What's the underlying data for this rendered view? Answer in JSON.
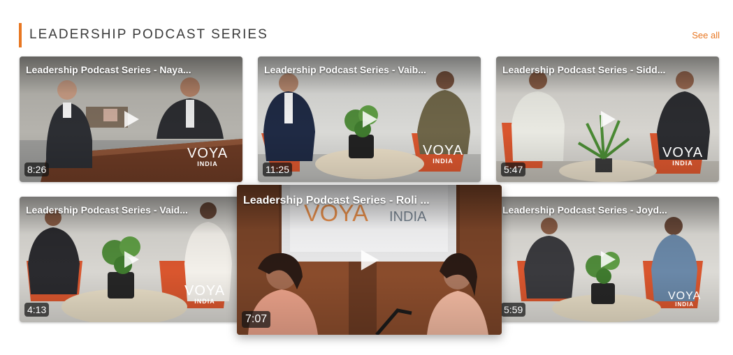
{
  "section": {
    "title": "LEADERSHIP PODCAST SERIES",
    "see_all": "See all",
    "accent_color": "#e87722"
  },
  "videos": [
    {
      "title": "Leadership Podcast Series - Naya...",
      "duration": "8:26",
      "brand": "VOYA",
      "brand_sub": "INDIA"
    },
    {
      "title": "Leadership Podcast Series - Vaib...",
      "duration": "11:25",
      "brand": "VOYA",
      "brand_sub": "INDIA"
    },
    {
      "title": "Leadership Podcast Series - Sidd...",
      "duration": "5:47",
      "brand": "VOYA",
      "brand_sub": "INDIA"
    },
    {
      "title": "Leadership Podcast Series - Vaid...",
      "duration": "4:13",
      "brand": "VOYA",
      "brand_sub": "INDIA"
    },
    {
      "title": "Leadership Podcast Series - Roli ...",
      "duration": "7:07",
      "brand": "VOYA",
      "brand_sub": "INDIA",
      "featured": true
    },
    {
      "title": "Leadership Podcast Series - Joyd...",
      "duration": "5:59",
      "brand": "VOYA",
      "brand_sub": "INDIA"
    }
  ],
  "icons": {
    "play": "play-icon"
  }
}
